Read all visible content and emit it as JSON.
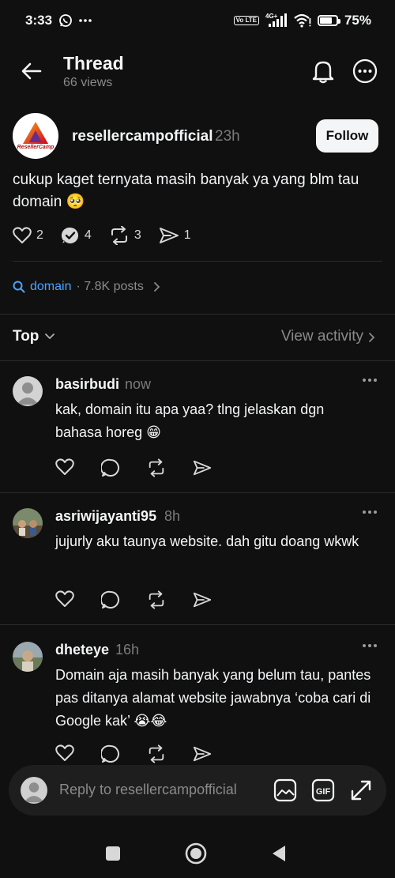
{
  "status_bar": {
    "time": "3:33",
    "network": "4G+",
    "volte": "Vo LTE",
    "battery": "75%",
    "battery_level": 0.75,
    "icons": [
      "whatsapp-icon",
      "more-dots-icon",
      "volte-icon",
      "signal-icon",
      "wifi-icon",
      "battery-icon"
    ]
  },
  "header": {
    "title": "Thread",
    "subtitle": "66 views",
    "icons": [
      "back-arrow-icon",
      "bell-icon",
      "more-circle-icon"
    ]
  },
  "post": {
    "author": "resellercampofficial",
    "time": "23h",
    "avatar_text": "ResellerCamp",
    "follow_label": "Follow",
    "text": "cukup kaget ternyata masih banyak ya yang blm tau domain 🥺",
    "likes": "2",
    "replies": "4",
    "reposts": "3",
    "shares": "1"
  },
  "tag": {
    "name": "domain",
    "count": "· 7.8K posts"
  },
  "sort": {
    "label": "Top",
    "view_activity": "View activity"
  },
  "replies": [
    {
      "user": "basirbudi",
      "time": "now",
      "text": "kak, domain itu apa yaa? tlng jelaskan dgn bahasa horeg 😁"
    },
    {
      "user": "asriwijayanti95",
      "time": "8h",
      "text": "jujurly aku taunya website. dah gitu doang wkwk"
    },
    {
      "user": "dheteye",
      "time": "16h",
      "text": "Domain aja masih banyak yang belum tau, pantes pas ditanya alamat website jawabnya ‘coba cari di Google kak’ 😭😂"
    }
  ],
  "reply_bar": {
    "placeholder": "Reply to resellercampofficial",
    "icons": [
      "image-icon",
      "gif-icon",
      "expand-icon"
    ]
  },
  "colors": {
    "background": "#101010",
    "text": "#f3f5f7",
    "muted": "#8a8a8a",
    "link": "#4aa3ff",
    "divider": "#2b2b2b"
  }
}
